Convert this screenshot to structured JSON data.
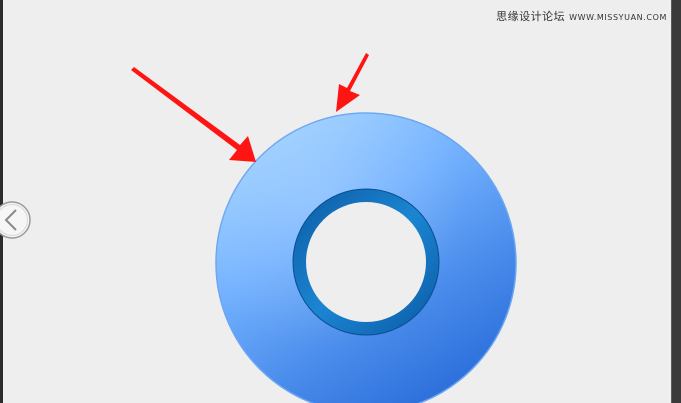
{
  "watermark": {
    "site_name": "思缘设计论坛",
    "site_url": "WWW.MISSYUAN.COM"
  },
  "colors": {
    "background": "#efeeee",
    "ring_light": "#8ec6ff",
    "ring_mid": "#5a9bf0",
    "ring_dark": "#2f72db",
    "inner_rim_dark": "#0e5fa8",
    "inner_rim_light": "#1f8fd8",
    "arrow": "#ff1a1a"
  },
  "icons": {
    "back": "chevron-left-circle-icon",
    "arrow_left": "red-arrow-icon",
    "arrow_top": "red-arrow-icon"
  }
}
